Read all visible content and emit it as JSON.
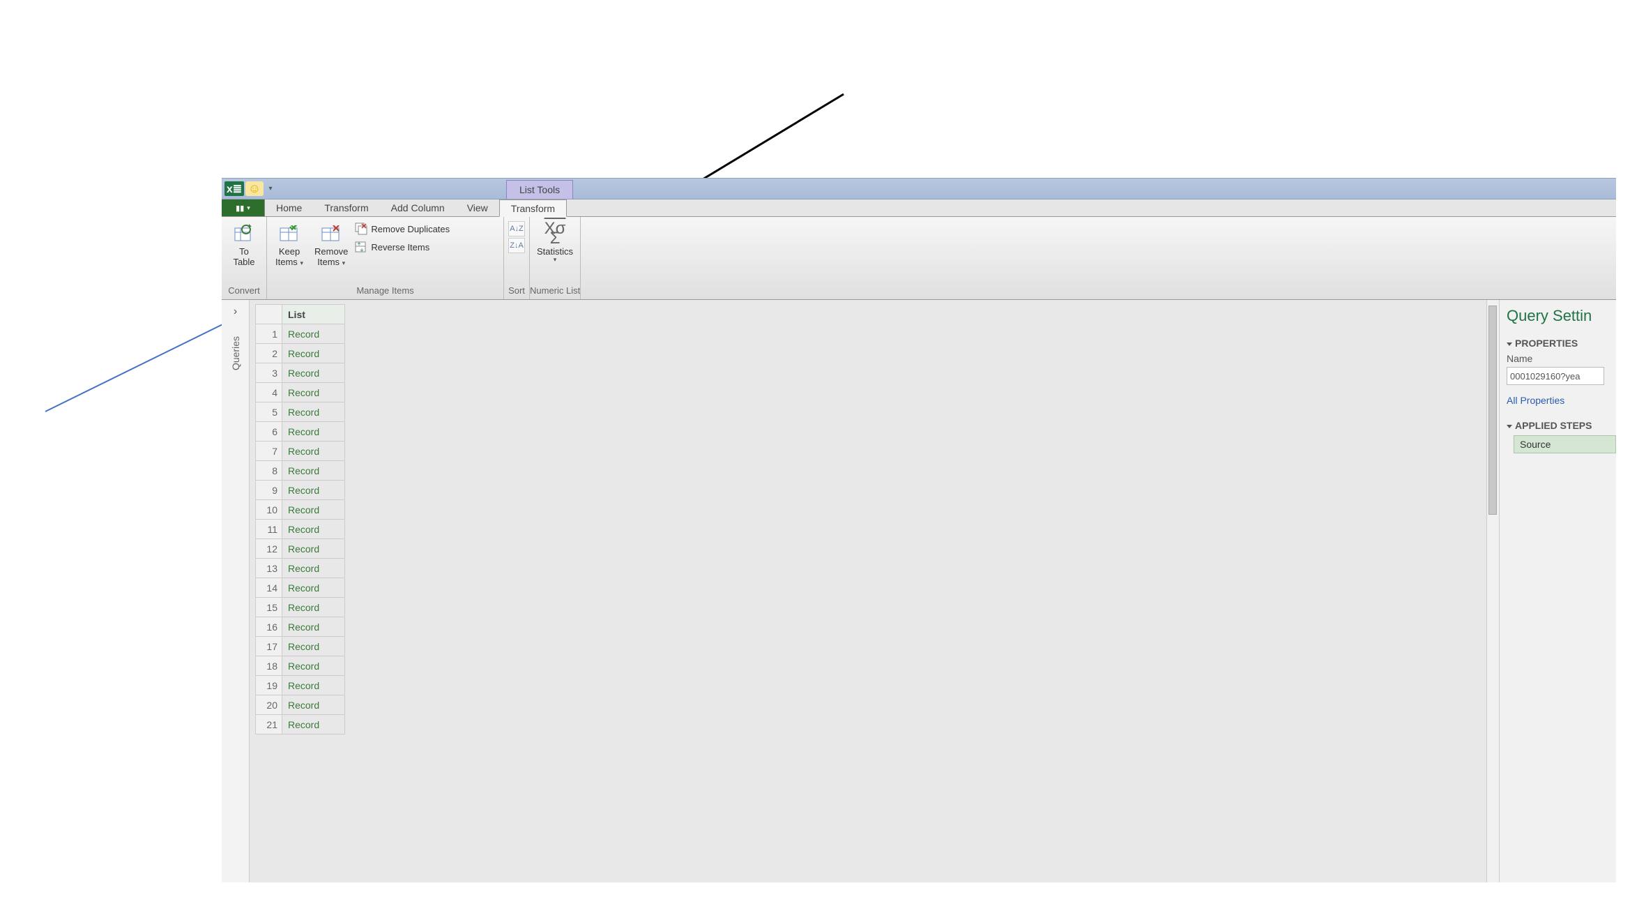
{
  "contextual_tab": "List Tools",
  "tabs": {
    "home": "Home",
    "transform": "Transform",
    "add_column": "Add Column",
    "view": "View",
    "context_transform": "Transform"
  },
  "ribbon": {
    "convert": {
      "to_table_1": "To",
      "to_table_2": "Table",
      "label": "Convert"
    },
    "manage": {
      "keep_1": "Keep",
      "keep_2": "Items",
      "remove_1": "Remove",
      "remove_2": "Items",
      "remove_dup": "Remove Duplicates",
      "reverse": "Reverse Items",
      "label": "Manage Items"
    },
    "sort": {
      "label": "Sort"
    },
    "numeric": {
      "stats": "Statistics",
      "label": "Numeric List"
    }
  },
  "rail_label": "Queries",
  "list_header": "List",
  "rows": [
    {
      "n": 1,
      "v": "Record"
    },
    {
      "n": 2,
      "v": "Record"
    },
    {
      "n": 3,
      "v": "Record"
    },
    {
      "n": 4,
      "v": "Record"
    },
    {
      "n": 5,
      "v": "Record"
    },
    {
      "n": 6,
      "v": "Record"
    },
    {
      "n": 7,
      "v": "Record"
    },
    {
      "n": 8,
      "v": "Record"
    },
    {
      "n": 9,
      "v": "Record"
    },
    {
      "n": 10,
      "v": "Record"
    },
    {
      "n": 11,
      "v": "Record"
    },
    {
      "n": 12,
      "v": "Record"
    },
    {
      "n": 13,
      "v": "Record"
    },
    {
      "n": 14,
      "v": "Record"
    },
    {
      "n": 15,
      "v": "Record"
    },
    {
      "n": 16,
      "v": "Record"
    },
    {
      "n": 17,
      "v": "Record"
    },
    {
      "n": 18,
      "v": "Record"
    },
    {
      "n": 19,
      "v": "Record"
    },
    {
      "n": 20,
      "v": "Record"
    },
    {
      "n": 21,
      "v": "Record"
    }
  ],
  "settings": {
    "title": "Query Settin",
    "properties": "PROPERTIES",
    "name_label": "Name",
    "name_value": "0001029160?yea",
    "all_props": "All Properties",
    "applied_steps": "APPLIED STEPS",
    "source": "Source"
  }
}
